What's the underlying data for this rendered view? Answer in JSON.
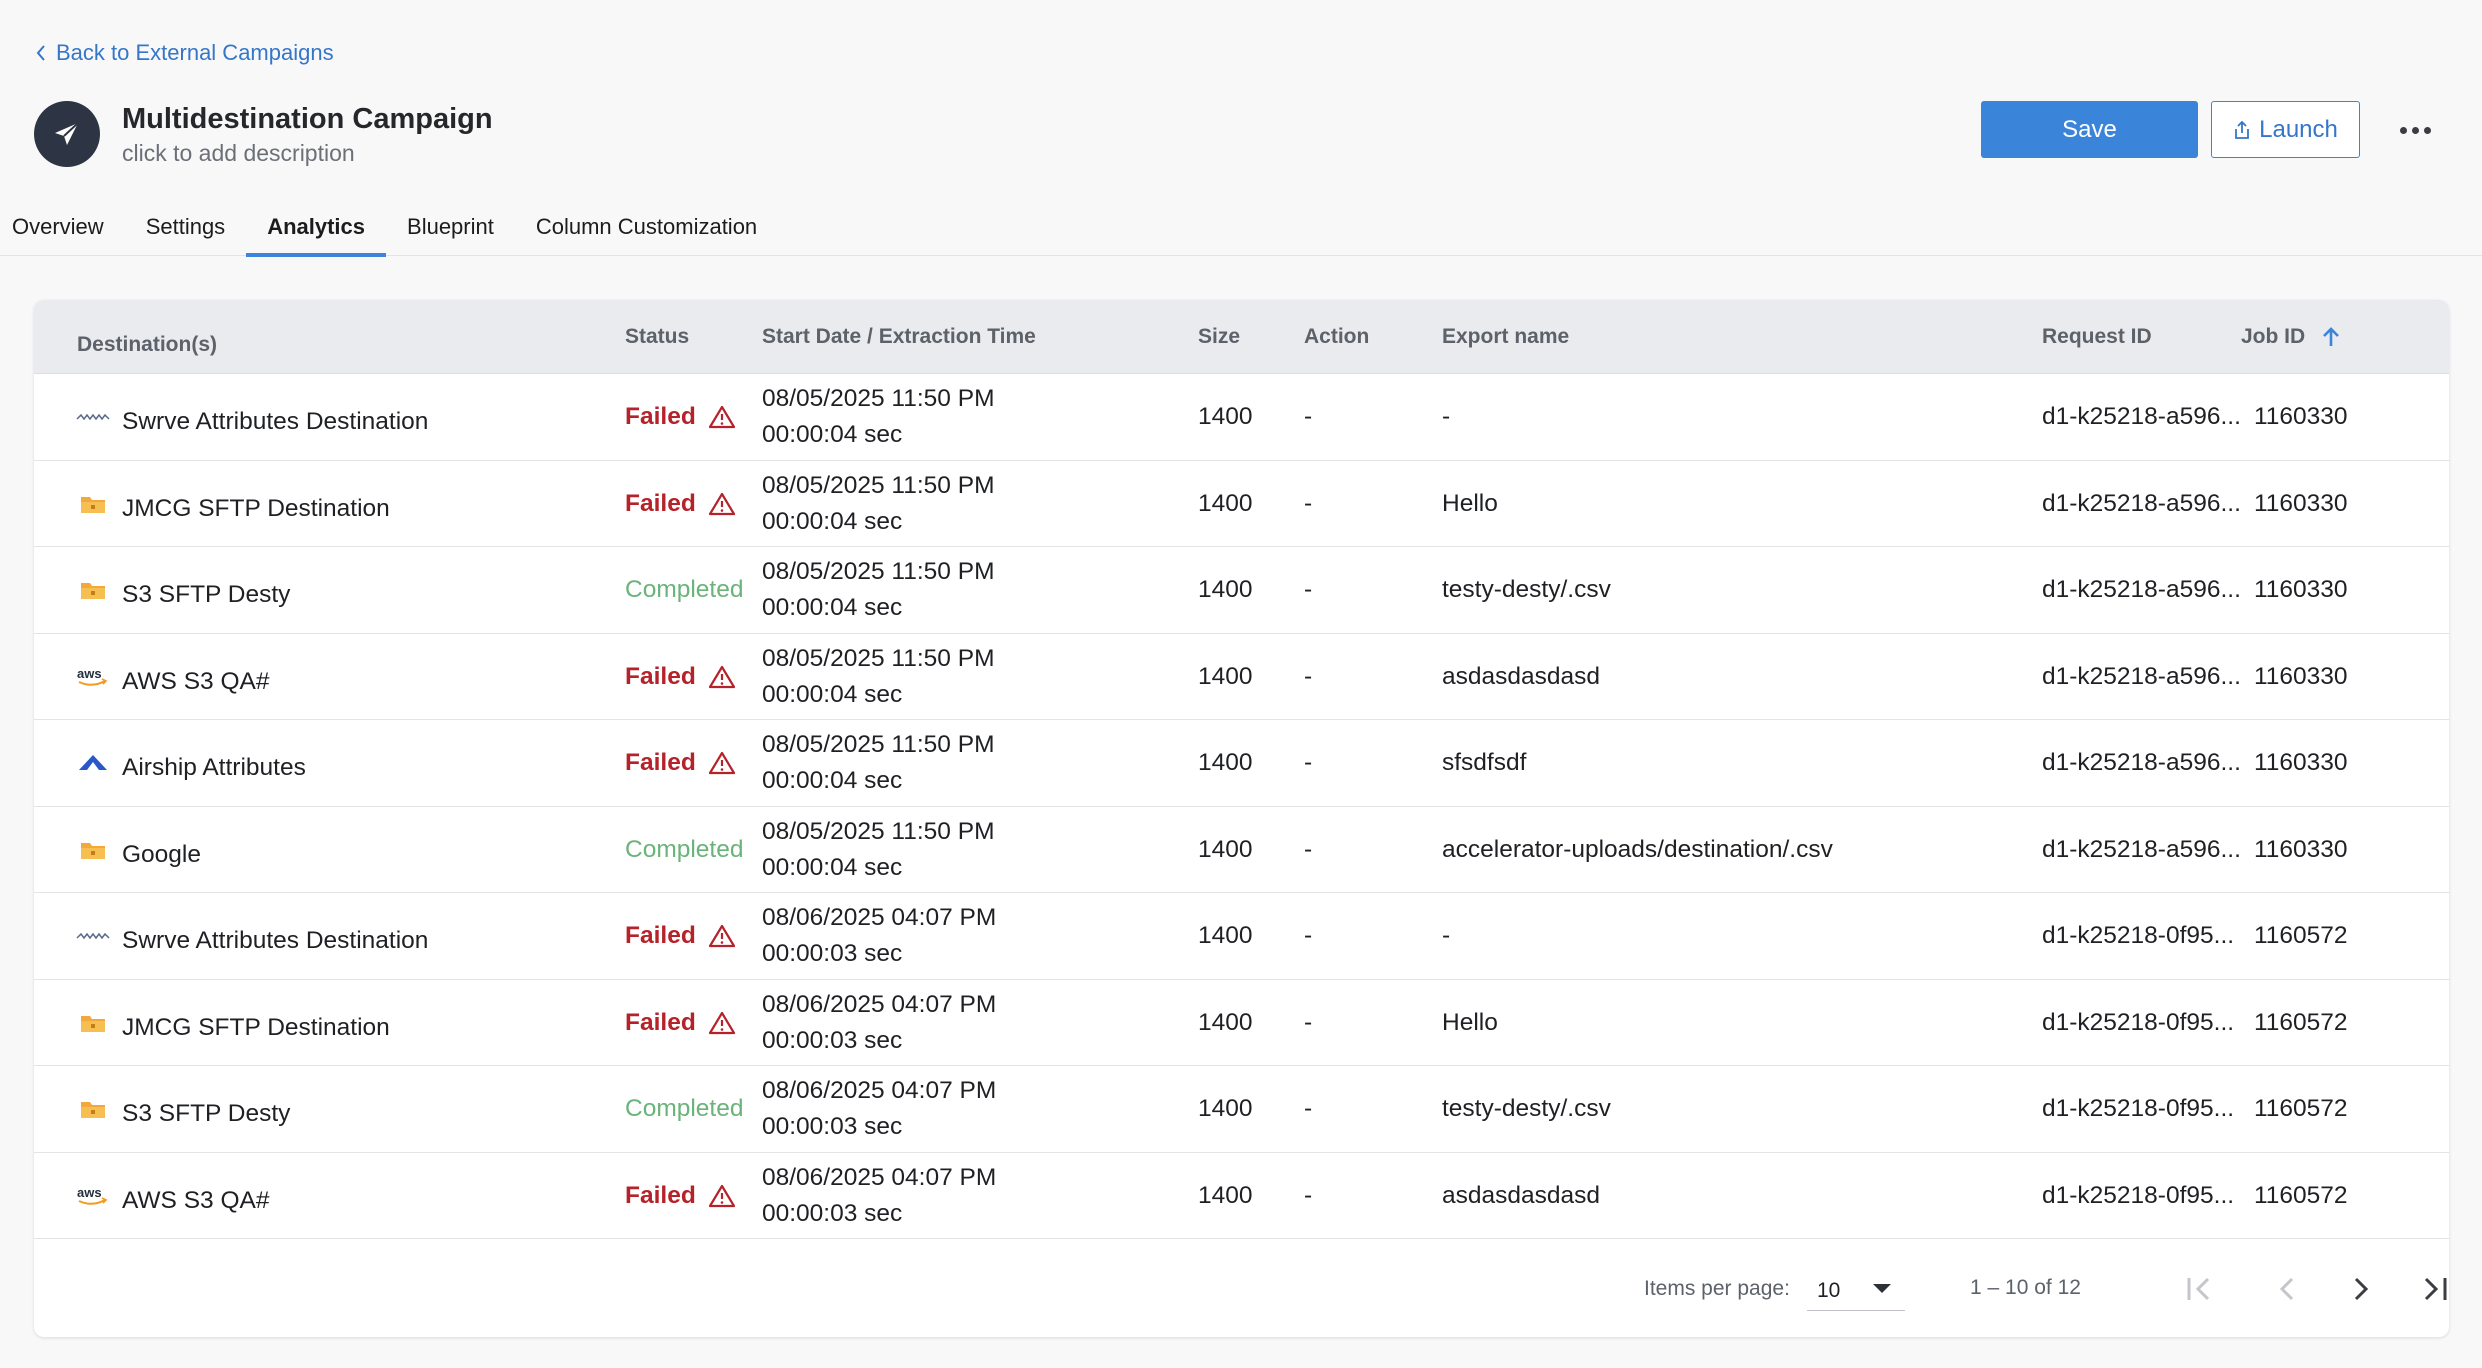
{
  "back_link": {
    "label": "Back to External Campaigns"
  },
  "header": {
    "title": "Multidestination Campaign",
    "description_placeholder": "click to add description",
    "save_label": "Save",
    "launch_label": "Launch"
  },
  "tabs": [
    {
      "label": "Overview",
      "active": false
    },
    {
      "label": "Settings",
      "active": false
    },
    {
      "label": "Analytics",
      "active": true
    },
    {
      "label": "Blueprint",
      "active": false
    },
    {
      "label": "Column Customization",
      "active": false
    }
  ],
  "table": {
    "columns": {
      "destination": "Destination(s)",
      "status": "Status",
      "start_date": "Start Date / Extraction Time",
      "size": "Size",
      "action": "Action",
      "export_name": "Export name",
      "request_id": "Request ID",
      "job_id": "Job ID"
    },
    "sort": {
      "column": "Job ID",
      "direction": "ascending"
    },
    "rows": [
      {
        "icon": "swrve-logo-icon",
        "destination": "Swrve Attributes Destination",
        "status": "Failed",
        "date": "08/05/2025 11:50 PM",
        "time": "00:00:04 sec",
        "size": "1400",
        "action": "-",
        "export_name": "-",
        "request_id": "d1-k25218-a596...",
        "job_id": "1160330"
      },
      {
        "icon": "folder-icon",
        "destination": "JMCG SFTP Destination",
        "status": "Failed",
        "date": "08/05/2025 11:50 PM",
        "time": "00:00:04 sec",
        "size": "1400",
        "action": "-",
        "export_name": "Hello",
        "request_id": "d1-k25218-a596...",
        "job_id": "1160330"
      },
      {
        "icon": "folder-icon",
        "destination": "S3 SFTP Desty",
        "status": "Completed",
        "date": "08/05/2025 11:50 PM",
        "time": "00:00:04 sec",
        "size": "1400",
        "action": "-",
        "export_name": "testy-desty/.csv",
        "request_id": "d1-k25218-a596...",
        "job_id": "1160330"
      },
      {
        "icon": "aws-logo-icon",
        "destination": "AWS S3 QA#",
        "status": "Failed",
        "date": "08/05/2025 11:50 PM",
        "time": "00:00:04 sec",
        "size": "1400",
        "action": "-",
        "export_name": "asdasdasdasd",
        "request_id": "d1-k25218-a596...",
        "job_id": "1160330"
      },
      {
        "icon": "airship-logo-icon",
        "destination": "Airship Attributes",
        "status": "Failed",
        "date": "08/05/2025 11:50 PM",
        "time": "00:00:04 sec",
        "size": "1400",
        "action": "-",
        "export_name": "sfsdfsdf",
        "request_id": "d1-k25218-a596...",
        "job_id": "1160330"
      },
      {
        "icon": "folder-icon",
        "destination": "Google",
        "status": "Completed",
        "date": "08/05/2025 11:50 PM",
        "time": "00:00:04 sec",
        "size": "1400",
        "action": "-",
        "export_name": "accelerator-uploads/destination/.csv",
        "request_id": "d1-k25218-a596...",
        "job_id": "1160330"
      },
      {
        "icon": "swrve-logo-icon",
        "destination": "Swrve Attributes Destination",
        "status": "Failed",
        "date": "08/06/2025 04:07 PM",
        "time": "00:00:03 sec",
        "size": "1400",
        "action": "-",
        "export_name": "-",
        "request_id": "d1-k25218-0f95...",
        "job_id": "1160572"
      },
      {
        "icon": "folder-icon",
        "destination": "JMCG SFTP Destination",
        "status": "Failed",
        "date": "08/06/2025 04:07 PM",
        "time": "00:00:03 sec",
        "size": "1400",
        "action": "-",
        "export_name": "Hello",
        "request_id": "d1-k25218-0f95...",
        "job_id": "1160572"
      },
      {
        "icon": "folder-icon",
        "destination": "S3 SFTP Desty",
        "status": "Completed",
        "date": "08/06/2025 04:07 PM",
        "time": "00:00:03 sec",
        "size": "1400",
        "action": "-",
        "export_name": "testy-desty/.csv",
        "request_id": "d1-k25218-0f95...",
        "job_id": "1160572"
      },
      {
        "icon": "aws-logo-icon",
        "destination": "AWS S3 QA#",
        "status": "Failed",
        "date": "08/06/2025 04:07 PM",
        "time": "00:00:03 sec",
        "size": "1400",
        "action": "-",
        "export_name": "asdasdasdasd",
        "request_id": "d1-k25218-0f95...",
        "job_id": "1160572"
      }
    ]
  },
  "pagination": {
    "items_per_page_label": "Items per page:",
    "items_per_page": "10",
    "range": "1 – 10 of 12"
  },
  "colors": {
    "accent": "#3a84da",
    "failed": "#b6222a",
    "completed": "#6ab37a"
  }
}
